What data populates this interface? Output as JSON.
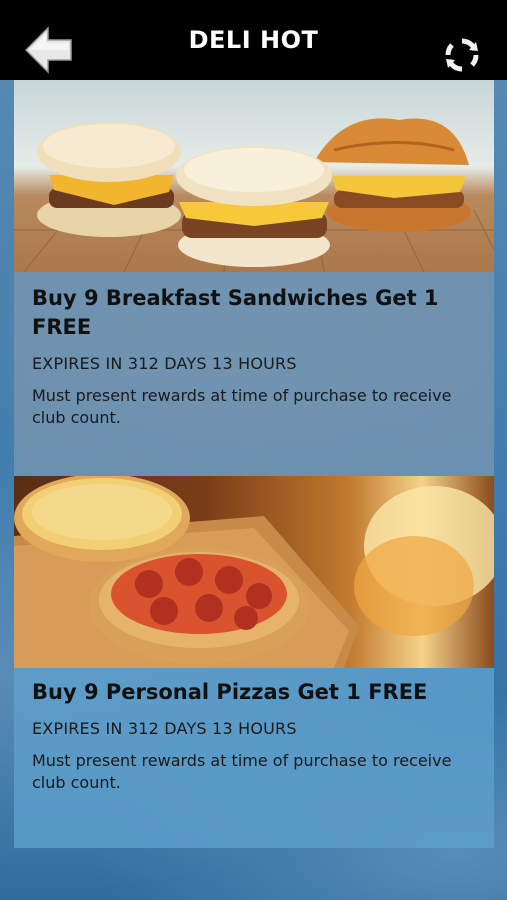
{
  "header": {
    "title": "DELI HOT",
    "back_icon": "back-arrow-icon",
    "refresh_icon": "refresh-icon"
  },
  "offers": [
    {
      "image": "breakfast-sandwiches-photo",
      "title": "Buy 9 Breakfast Sandwiches Get 1 FREE",
      "expiry": "EXPIRES IN 312 DAYS 13 HOURS",
      "description": "Must present rewards at time of purchase to receive club count."
    },
    {
      "image": "personal-pizzas-photo",
      "title": "Buy 9 Personal Pizzas Get 1 FREE",
      "expiry": "EXPIRES IN 312 DAYS 13 HOURS",
      "description": "Must present rewards at time of purchase to receive club count."
    }
  ],
  "colors": {
    "topbar": "#000000",
    "card1_bg": "#7896af",
    "card2_bg": "#5fa0cd",
    "page_bg": "#3f7cad"
  }
}
